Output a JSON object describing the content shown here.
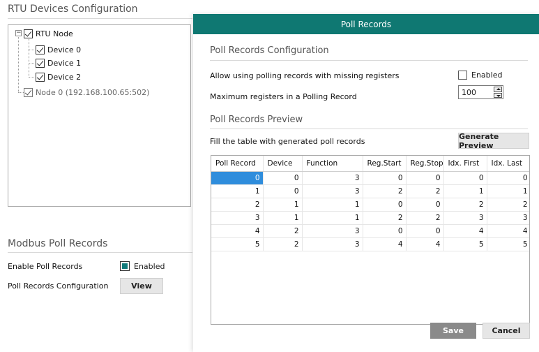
{
  "left": {
    "devices_title": "RTU Devices Configuration",
    "tree": {
      "root": "RTU Node",
      "devices": [
        "Device 0",
        "Device 1",
        "Device 2"
      ],
      "node0": "Node 0 (192.168.100.65:502)"
    },
    "modbus_title": "Modbus Poll Records",
    "enable_label": "Enable Poll Records",
    "enable_value": "Enabled",
    "config_label": "Poll Records Configuration",
    "view_button": "View"
  },
  "dialog": {
    "title": "Poll Records",
    "config_section": "Poll Records Configuration",
    "allow_missing_label": "Allow using polling records with missing registers",
    "allow_missing_value": "Enabled",
    "max_registers_label": "Maximum registers in a Polling Record",
    "max_registers_value": "100",
    "preview_section": "Poll Records Preview",
    "fill_label": "Fill the table with generated poll records",
    "generate_button": "Generate Preview",
    "table": {
      "headers": [
        "Poll Record",
        "Device",
        "Function",
        "Reg.Start",
        "Reg.Stop",
        "Idx. First",
        "Idx. Last"
      ],
      "rows": [
        [
          "0",
          "0",
          "3",
          "0",
          "0",
          "0",
          "0"
        ],
        [
          "1",
          "0",
          "3",
          "2",
          "2",
          "1",
          "1"
        ],
        [
          "2",
          "1",
          "1",
          "0",
          "0",
          "2",
          "2"
        ],
        [
          "3",
          "1",
          "1",
          "2",
          "2",
          "3",
          "3"
        ],
        [
          "4",
          "2",
          "3",
          "0",
          "0",
          "4",
          "4"
        ],
        [
          "5",
          "2",
          "3",
          "4",
          "4",
          "5",
          "5"
        ]
      ]
    },
    "save_button": "Save",
    "cancel_button": "Cancel"
  },
  "colors": {
    "header_teal": "#0f7872",
    "selection_blue": "#2f8ddc",
    "save_gray": "#8a8a8a"
  }
}
